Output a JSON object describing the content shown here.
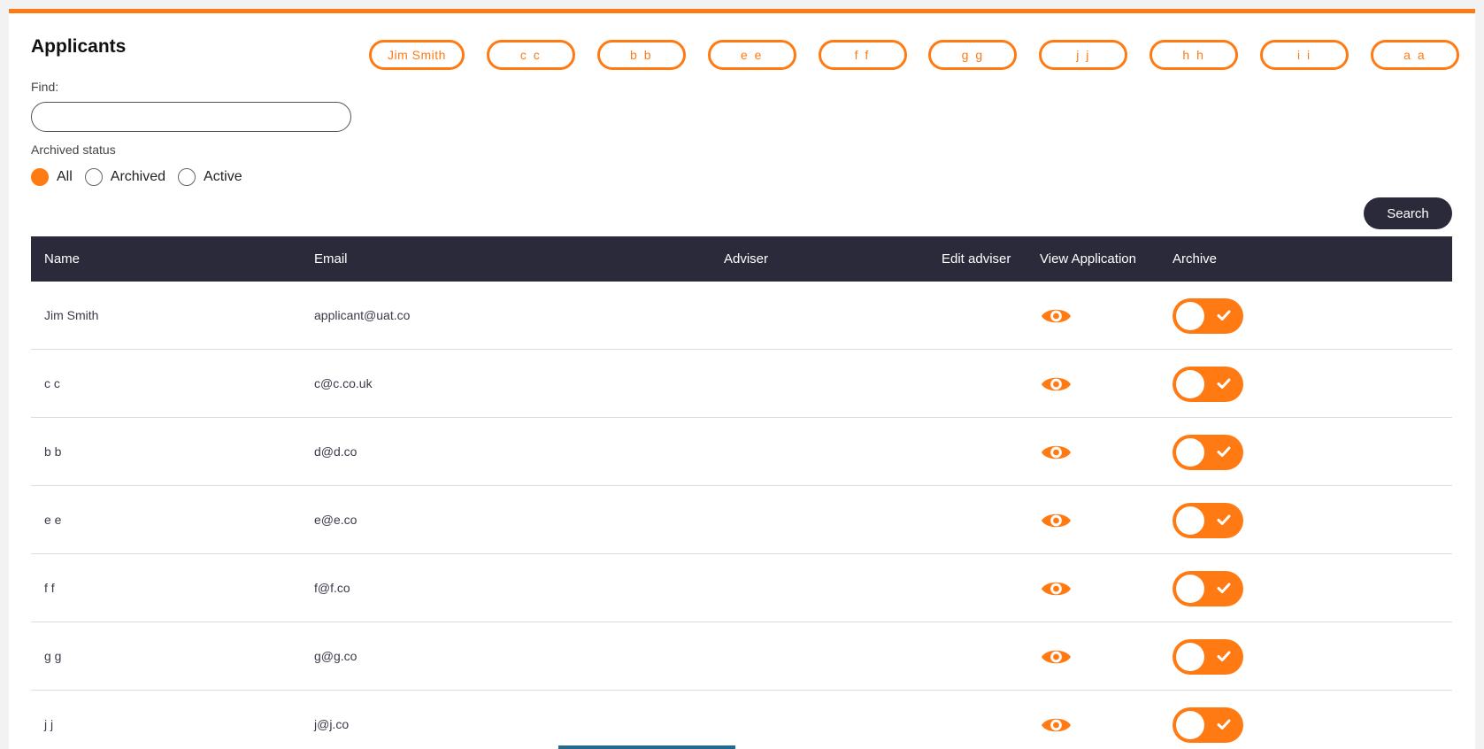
{
  "page": {
    "title": "Applicants",
    "find_label": "Find:",
    "find_value": "",
    "archived_status_label": "Archived status",
    "radio_options": [
      {
        "label": "All",
        "checked": true
      },
      {
        "label": "Archived",
        "checked": false
      },
      {
        "label": "Active",
        "checked": false
      }
    ],
    "search_button": "Search"
  },
  "pills": [
    "Jim Smith",
    "c c",
    "b b",
    "e e",
    "f f",
    "g g",
    "j j",
    "h h",
    "i i",
    "a a"
  ],
  "table": {
    "headers": {
      "name": "Name",
      "email": "Email",
      "adviser": "Adviser",
      "edit_adviser": "Edit adviser",
      "view_application": "View Application",
      "archive": "Archive"
    },
    "rows": [
      {
        "name": "Jim Smith",
        "email": "applicant@uat.co",
        "adviser": ""
      },
      {
        "name": "c c",
        "email": "c@c.co.uk",
        "adviser": ""
      },
      {
        "name": "b b",
        "email": "d@d.co",
        "adviser": ""
      },
      {
        "name": "e e",
        "email": "e@e.co",
        "adviser": ""
      },
      {
        "name": "f f",
        "email": "f@f.co",
        "adviser": ""
      },
      {
        "name": "g g",
        "email": "g@g.co",
        "adviser": ""
      },
      {
        "name": "j j",
        "email": "j@j.co",
        "adviser": ""
      }
    ]
  },
  "colors": {
    "accent": "#ff7a12",
    "dark": "#2a2a3a",
    "footer_button": "#256a8a"
  },
  "icons": {
    "view": "eye-icon",
    "archive_toggle_check": "check-icon"
  }
}
